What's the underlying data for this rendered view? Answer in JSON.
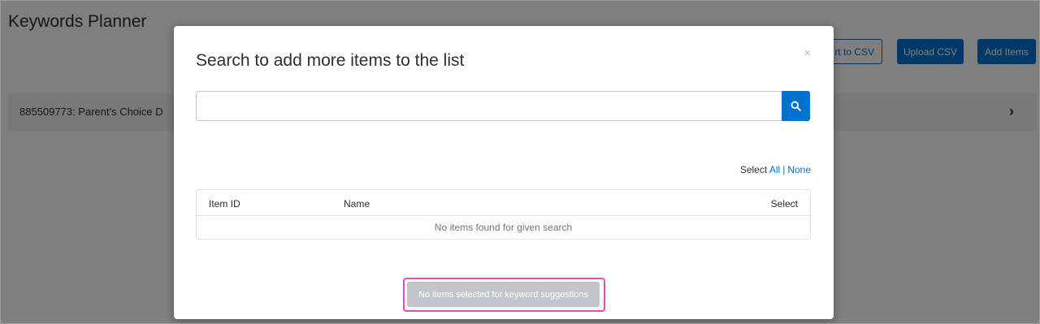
{
  "page": {
    "title": "Keywords Planner",
    "toolbar": {
      "export_label": "rt to CSV",
      "upload_label": "Upload CSV",
      "add_label": "Add Items"
    },
    "item_row": {
      "label": "885509773: Parent's Choice D"
    }
  },
  "modal": {
    "title": "Search to add more items to the list",
    "close_symbol": "×",
    "search": {
      "value": "",
      "placeholder": ""
    },
    "select": {
      "prefix": "Select",
      "all_label": "All",
      "separator": "|",
      "none_label": "None"
    },
    "table": {
      "columns": [
        "Item ID",
        "Name",
        "Select"
      ],
      "empty_message": "No items found for given search"
    },
    "suggest_button_label": "No items selected for keyword suggestions"
  },
  "colors": {
    "accent": "#0071ce",
    "highlight": "#e24bc1",
    "disabled_button": "#c4c5ca"
  },
  "icons": {
    "search": "search-icon",
    "close": "close-icon",
    "chevron": "chevron-right-icon"
  }
}
